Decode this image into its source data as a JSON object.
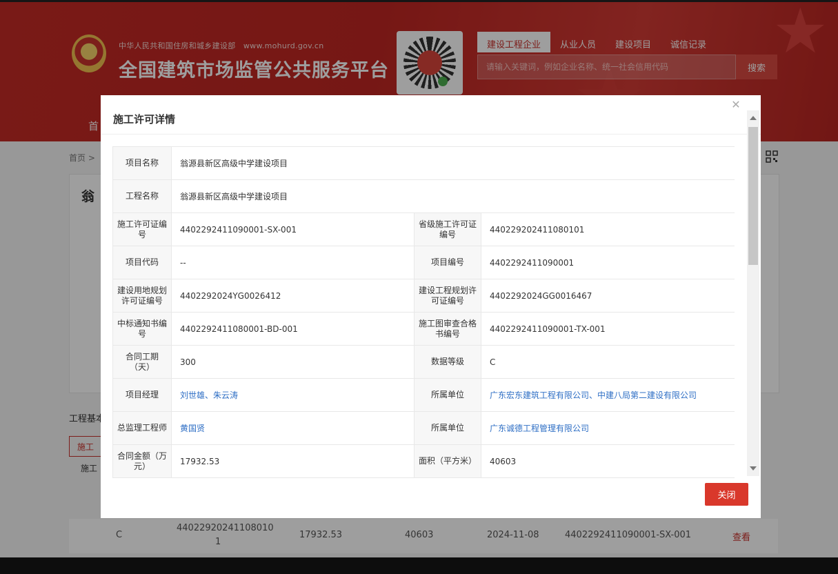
{
  "header": {
    "org_name": "中华人民共和国住房和城乡建设部",
    "org_url": "www.mohurd.gov.cn",
    "site_title": "全国建筑市场监管公共服务平台",
    "tabs": [
      {
        "label": "建设工程企业",
        "active": true
      },
      {
        "label": "从业人员",
        "active": false
      },
      {
        "label": "建设项目",
        "active": false
      },
      {
        "label": "诚信记录",
        "active": false
      }
    ],
    "search_placeholder": "请输入关键词，例如企业名称、统一社会信用代码",
    "search_button": "搜索",
    "nav_home": "首"
  },
  "page": {
    "breadcrumb": "首页 >",
    "project_title": "翁",
    "basic_info_label": "工程基本",
    "sub_tab_label": "施工",
    "sub_label": "施工",
    "bottom_row": {
      "grade": "C",
      "permit_line1": "44022920241108010",
      "permit_line2": "1",
      "amount": "17932.53",
      "area": "40603",
      "date": "2024-11-08",
      "permit_no": "4402292411090001-SX-001",
      "action": "查看"
    }
  },
  "modal": {
    "title": "施工许可详情",
    "close_label": "关闭",
    "rows": [
      {
        "label1": "项目名称",
        "value1": "翁源县新区高级中学建设项目"
      },
      {
        "label1": "工程名称",
        "value1": "翁源县新区高级中学建设项目"
      },
      {
        "label1": "施工许可证编号",
        "value1": "4402292411090001-SX-001",
        "label2": "省级施工许可证编号",
        "value2": "440229202411080101"
      },
      {
        "label1": "项目代码",
        "value1": "--",
        "label2": "项目编号",
        "value2": "4402292411090001"
      },
      {
        "label1": "建设用地规划许可证编号",
        "value1": "4402292024YG0026412",
        "label2": "建设工程规划许可证编号",
        "value2": "4402292024GG0016467"
      },
      {
        "label1": "中标通知书编号",
        "value1": "4402292411080001-BD-001",
        "label2": "施工图审查合格书编号",
        "value2": "4402292411090001-TX-001"
      },
      {
        "label1": "合同工期（天）",
        "value1": "300",
        "label2": "数据等级",
        "value2": "C"
      },
      {
        "label1": "项目经理",
        "value1": "刘世雄、朱云涛",
        "label2": "所属单位",
        "value2": "广东宏东建筑工程有限公司、中建八局第二建设有限公司",
        "link": true
      },
      {
        "label1": "总监理工程师",
        "value1": "黄国贤",
        "label2": "所属单位",
        "value2": "广东诚德工程管理有限公司",
        "link": true
      },
      {
        "label1": "合同金额（万元）",
        "value1": "17932.53",
        "label2": "面积（平方米）",
        "value2": "40603"
      }
    ]
  },
  "colors": {
    "brand_red": "#c42a26",
    "link_blue": "#2f6fc5",
    "button_red": "#d9382b"
  }
}
